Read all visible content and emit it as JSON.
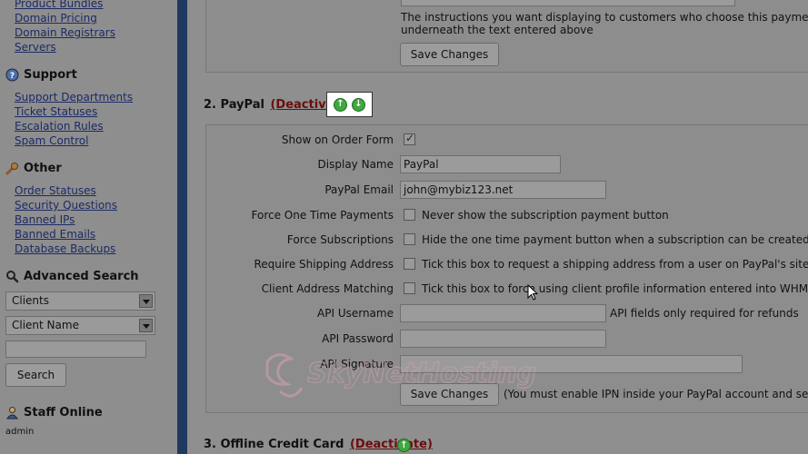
{
  "sidebar": {
    "top_links": [
      "Product Bundles",
      "Domain Pricing",
      "Domain Registrars",
      "Servers"
    ],
    "support": {
      "title": "Support",
      "links": [
        "Support Departments",
        "Ticket Statuses",
        "Escalation Rules",
        "Spam Control"
      ]
    },
    "other": {
      "title": "Other",
      "links": [
        "Order Statuses",
        "Security Questions",
        "Banned IPs",
        "Banned Emails",
        "Database Backups"
      ]
    },
    "advanced_search": {
      "title": "Advanced Search",
      "select1": "Clients",
      "select2": "Client Name",
      "search_button": "Search"
    },
    "staff_online": {
      "title": "Staff Online",
      "user": "admin"
    }
  },
  "top_panel": {
    "instructions_text_1": "The instructions you want displaying to customers who choose this payment met",
    "instructions_text_2": "underneath the text entered above",
    "save_button": "Save Changes"
  },
  "paypal": {
    "heading": "2. PayPal",
    "deactivate": "(Deactivate)",
    "fields": {
      "show_on_order_form": {
        "label": "Show on Order Form",
        "checked": true
      },
      "display_name": {
        "label": "Display Name",
        "value": "PayPal"
      },
      "paypal_email": {
        "label": "PayPal Email",
        "value": "john@mybiz123.net"
      },
      "force_one_time": {
        "label": "Force One Time Payments",
        "desc": "Never show the subscription payment button"
      },
      "force_subscriptions": {
        "label": "Force Subscriptions",
        "desc": "Hide the one time payment button when a subscription can be created"
      },
      "require_shipping": {
        "label": "Require Shipping Address",
        "desc": "Tick this box to request a shipping address from a user on PayPal's site"
      },
      "client_address": {
        "label": "Client Address Matching",
        "desc": "Tick this box to force using client profile information entered into WHMCS at"
      },
      "api_username": {
        "label": "API Username",
        "note": "API fields only required for refunds"
      },
      "api_password": {
        "label": "API Password"
      },
      "api_signature": {
        "label": "API Signature"
      }
    },
    "save_button": "Save Changes",
    "save_note": "(You must enable IPN inside your PayPal account and set the"
  },
  "offline_cc": {
    "heading": "3. Offline Credit Card",
    "deactivate": "(Deactivate)"
  },
  "watermark_text": "SkyNetHosting.net"
}
